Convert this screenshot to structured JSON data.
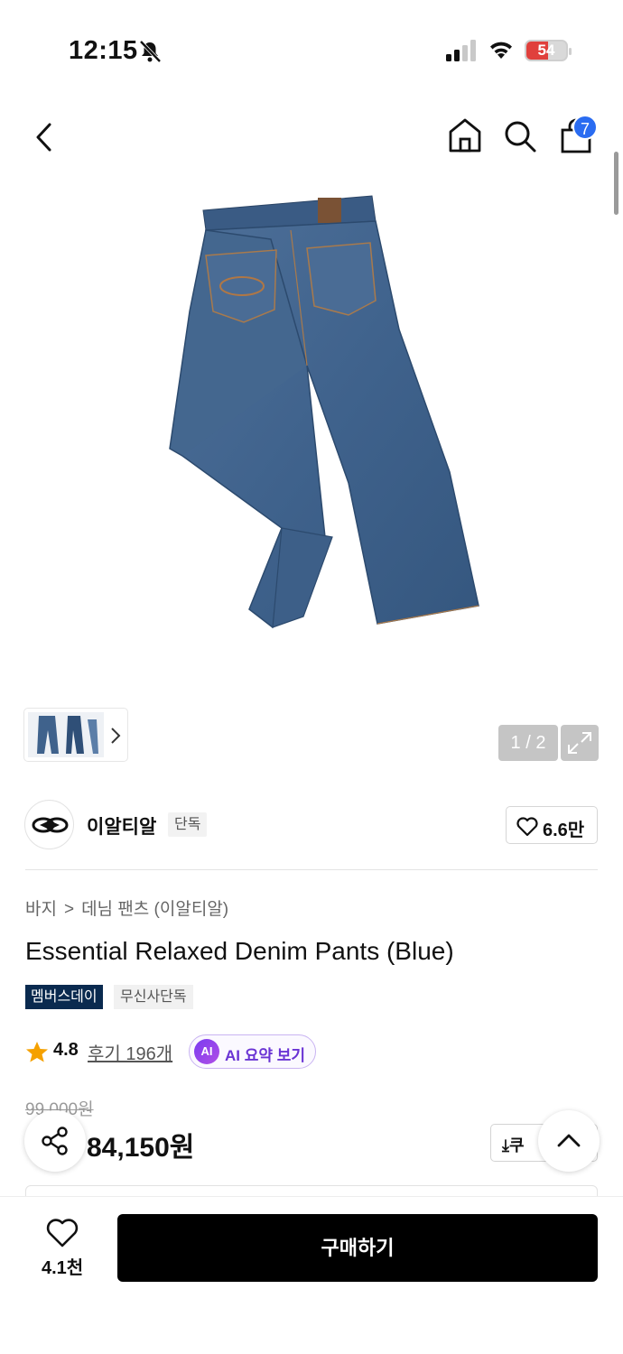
{
  "status_bar": {
    "time": "12:15",
    "battery": "54",
    "battery_level": 0.54,
    "colors": {
      "battery_fill": "#e0403c"
    }
  },
  "nav": {
    "cart_count": "7",
    "badge_color": "#2a6cf1"
  },
  "gallery": {
    "counter": "1 / 2"
  },
  "brand": {
    "name": "이알티알",
    "tag": "단독",
    "like_count": "6.6만"
  },
  "breadcrumb": [
    "바지",
    ">",
    "데님 팬츠 (이알티알)"
  ],
  "product": {
    "title": "Essential Relaxed Denim Pants (Blue)",
    "badges": [
      "멤버스데이",
      "무신사단독"
    ],
    "rating": "4.8",
    "reviews": "후기 196개",
    "ai_summary_label": "AI 요약 보기",
    "ai_badge": "AI",
    "original_price": "99,000원",
    "price": "84,150원",
    "coupon_label": "⤓쿠"
  },
  "bottom_bar": {
    "like_count": "4.1천",
    "buy_label": "구매하기"
  }
}
